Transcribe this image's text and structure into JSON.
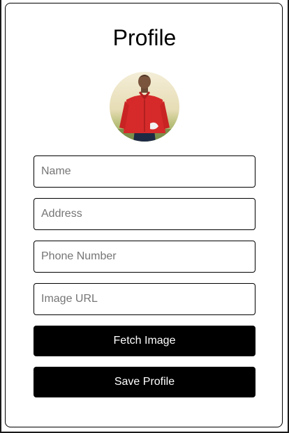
{
  "profile": {
    "title": "Profile",
    "fields": {
      "name_placeholder": "Name",
      "name_value": "",
      "address_placeholder": "Address",
      "address_value": "",
      "phone_placeholder": "Phone Number",
      "phone_value": "",
      "image_url_placeholder": "Image URL",
      "image_url_value": ""
    },
    "buttons": {
      "fetch_image": "Fetch Image",
      "save_profile": "Save Profile"
    }
  },
  "colors": {
    "button_bg": "#000000",
    "button_text": "#ffffff",
    "border": "#000000",
    "placeholder": "#757575"
  }
}
